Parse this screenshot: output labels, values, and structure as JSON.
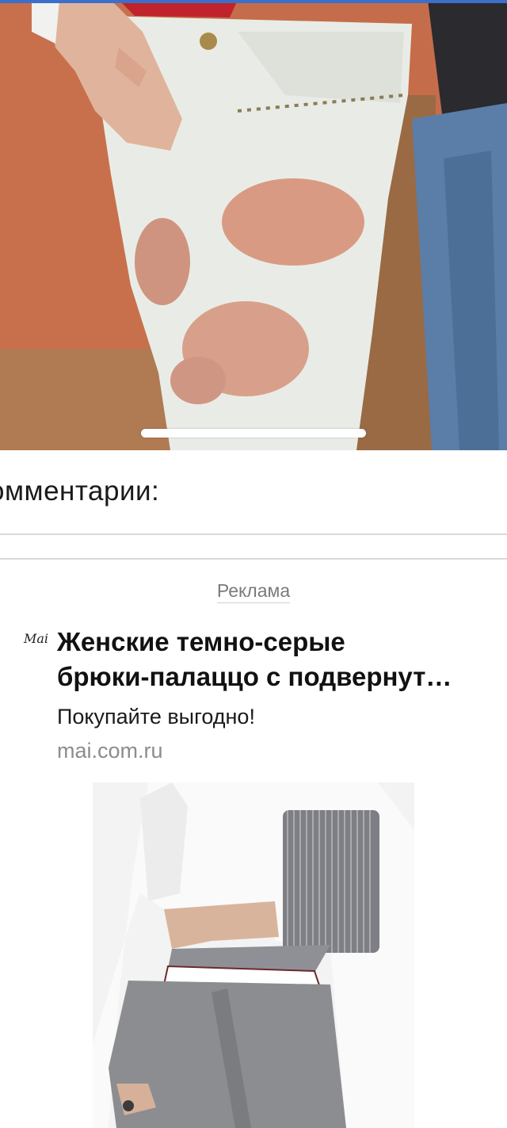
{
  "comments": {
    "header": "омментарии:"
  },
  "ad": {
    "label": "Реклама",
    "brand_logo": "Mai",
    "title_line1": "Женские темно-серые",
    "title_line2": "брюки-палаццо с подвернут…",
    "subtitle": "Покупайте выгодно!",
    "domain": "mai.com.ru"
  },
  "icons": {
    "top_photo": "photo-jeans-image",
    "ad_photo": "photo-trousers-image"
  },
  "colors": {
    "accent_line": "#3d6fc9",
    "text_primary": "#111111",
    "text_secondary": "#8c8c8c"
  }
}
